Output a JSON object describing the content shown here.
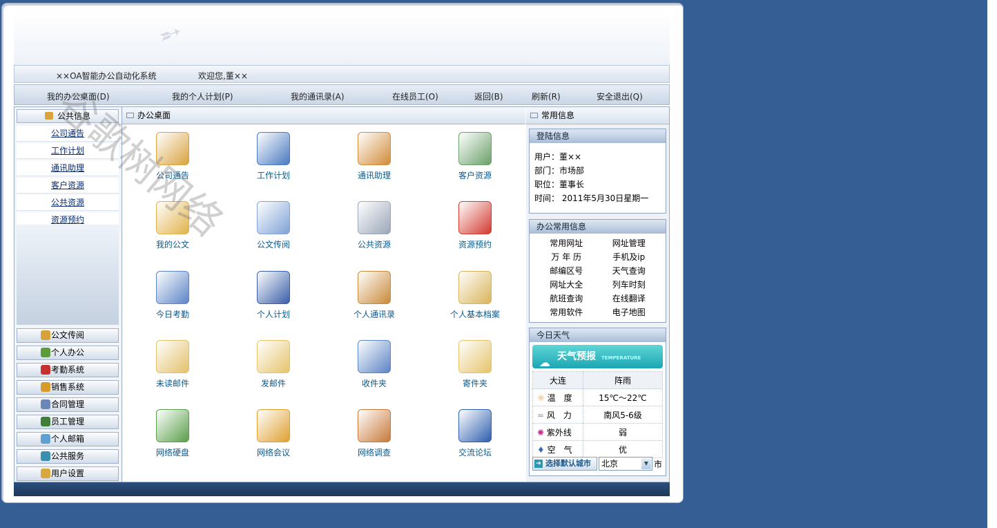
{
  "header": {
    "system_title": "××OA智能办公自动化系统",
    "welcome": "欢迎您,董××"
  },
  "menu": [
    {
      "label": "我的办公桌面(D)"
    },
    {
      "label": "我的个人计划(P)"
    },
    {
      "label": "我的通讯录(A)"
    },
    {
      "label": "在线员工(O)"
    },
    {
      "label": "返回(B)"
    },
    {
      "label": "刷新(R)"
    },
    {
      "label": "安全退出(Q)"
    }
  ],
  "sidebar": {
    "active_group": "公共信息",
    "sub_items": [
      {
        "label": "公司通告"
      },
      {
        "label": "工作计划"
      },
      {
        "label": "通讯助理"
      },
      {
        "label": "客户资源"
      },
      {
        "label": "公共资源"
      },
      {
        "label": "资源预约"
      }
    ],
    "groups": [
      {
        "label": "公文传阅",
        "icon": "document-icon",
        "color": "#d7a23a"
      },
      {
        "label": "个人办公",
        "icon": "person-icon",
        "color": "#5c9c3c"
      },
      {
        "label": "考勤系统",
        "icon": "clock-icon",
        "color": "#c8302e"
      },
      {
        "label": "销售系统",
        "icon": "box-icon",
        "color": "#d49a2a"
      },
      {
        "label": "合同管理",
        "icon": "contract-icon",
        "color": "#6a86b8"
      },
      {
        "label": "员工管理",
        "icon": "users-icon",
        "color": "#3f7f3a"
      },
      {
        "label": "个人邮箱",
        "icon": "mailbox-icon",
        "color": "#5fa0d0"
      },
      {
        "label": "公共服务",
        "icon": "globe-icon",
        "color": "#3a8fb0"
      },
      {
        "label": "用户设置",
        "icon": "settings-icon",
        "color": "#d8a83c"
      }
    ]
  },
  "desktop": {
    "title": "办公桌面",
    "items": [
      {
        "label": "公司通告",
        "icon": "notice-icon",
        "color": "#d9a340"
      },
      {
        "label": "工作计划",
        "icon": "calendar-icon",
        "color": "#4a79c0"
      },
      {
        "label": "通讯助理",
        "icon": "book-icon",
        "color": "#d28c3a"
      },
      {
        "label": "客户资源",
        "icon": "contact-card-icon",
        "color": "#6aa06a"
      },
      {
        "label": "我的公文",
        "icon": "folder-pen-icon",
        "color": "#e2b24a"
      },
      {
        "label": "公文传阅",
        "icon": "documents-icon",
        "color": "#7fa2d6"
      },
      {
        "label": "公共资源",
        "icon": "printer-icon",
        "color": "#9aa6b8"
      },
      {
        "label": "资源预约",
        "icon": "car-icon",
        "color": "#d23a30"
      },
      {
        "label": "今日考勤",
        "icon": "calendar-clock-icon",
        "color": "#5c84c6"
      },
      {
        "label": "个人计划",
        "icon": "date-14-icon",
        "color": "#3a5fa8"
      },
      {
        "label": "个人通讯录",
        "icon": "address-book-icon",
        "color": "#c98a3a"
      },
      {
        "label": "个人基本档案",
        "icon": "profile-envelope-icon",
        "color": "#d9b45a"
      },
      {
        "label": "未读邮件",
        "icon": "mail-clock-icon",
        "color": "#e3c06a"
      },
      {
        "label": "发邮件",
        "icon": "send-mail-icon",
        "color": "#e5c46c"
      },
      {
        "label": "收件夹",
        "icon": "inbox-icon",
        "color": "#5c84c6"
      },
      {
        "label": "寄件夹",
        "icon": "outbox-icon",
        "color": "#e5c46c"
      },
      {
        "label": "网络硬盘",
        "icon": "network-drive-icon",
        "color": "#5a9e4a"
      },
      {
        "label": "网络会议",
        "icon": "meeting-icon",
        "color": "#e0a030"
      },
      {
        "label": "网络调查",
        "icon": "survey-clipboard-icon",
        "color": "#c8793a"
      },
      {
        "label": "交流论坛",
        "icon": "forum-icon",
        "color": "#2f5fae"
      }
    ]
  },
  "right_panel": {
    "title": "常用信息",
    "login": {
      "title": "登陆信息",
      "user": "用户：董××",
      "dept": "部门：市场部",
      "position": "职位：董事长",
      "time": "时间： 2011年5月30日星期一"
    },
    "office_links": {
      "title": "办公常用信息",
      "items": [
        "常用网址",
        "网址管理",
        "万 年 历",
        "手机及ip",
        "邮编区号",
        "天气查询",
        "网址大全",
        "列车时刻",
        "航班查询",
        "在线翻译",
        "常用软件",
        "电子地图"
      ]
    },
    "weather": {
      "title": "今日天气",
      "banner": "天气预报",
      "banner_sub": "TEMPERATURE",
      "city": "大连",
      "condition": "阵雨",
      "rows": [
        {
          "label": "温　度",
          "value": "15℃～22℃",
          "icon": "sun-icon",
          "color": "#e08a1a"
        },
        {
          "label": "风　力",
          "value": "南风5-6级",
          "icon": "wind-icon",
          "color": "#8a9aaa"
        },
        {
          "label": "紫外线",
          "value": "弱",
          "icon": "uv-icon",
          "color": "#c02a8a"
        },
        {
          "label": "空　气",
          "value": "优",
          "icon": "drops-icon",
          "color": "#3a6ab0"
        }
      ],
      "select_city_label": "选择默认城市",
      "selected_city": "北京",
      "city_unit": "市"
    }
  },
  "watermark": "谷歌树网络"
}
